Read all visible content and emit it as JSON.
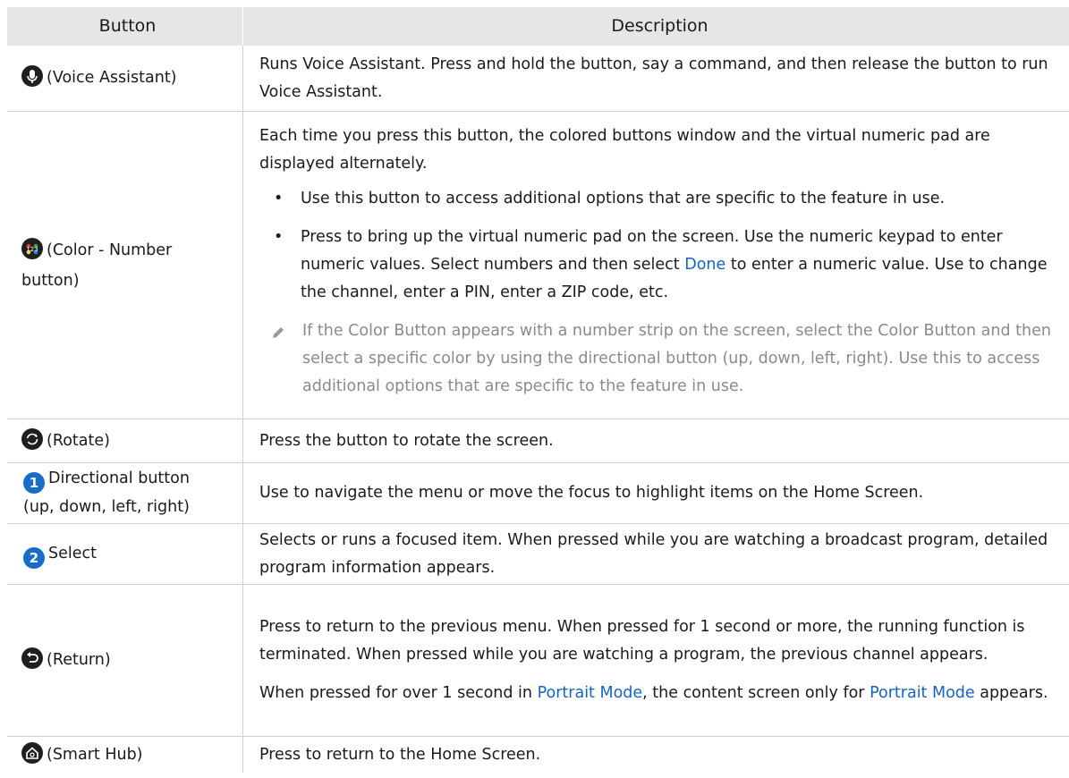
{
  "header": {
    "button": "Button",
    "description": "Description"
  },
  "rows": {
    "voice": {
      "icon": "microphone-icon",
      "label": "(Voice Assistant)",
      "desc": "Runs Voice Assistant. Press and hold the button, say a command, and then release the button to run Voice Assistant."
    },
    "color": {
      "icon": "color-number-icon",
      "label": "(Color - Number button)",
      "desc": "Each time you press this button, the colored buttons window and the virtual numeric pad are displayed alternately.",
      "bullet1": "Use this button to access additional options that are specific to the feature in use.",
      "bullet2_a": "Press to bring up the virtual numeric pad on the screen. Use the numeric keypad to enter numeric values. Select numbers and then select ",
      "bullet2_link": "Done",
      "bullet2_b": " to enter a numeric value. Use to change the channel, enter a PIN, enter a ZIP code, etc.",
      "note": "If the Color Button appears with a number strip on the screen, select the Color Button and then select a specific color by using the directional button (up, down, left, right). Use this to access additional options that are specific to the feature in use."
    },
    "rotate": {
      "icon": "rotate-icon",
      "label": "(Rotate)",
      "desc": "Press the button to rotate the screen."
    },
    "directional": {
      "num": "1",
      "label1": "Directional button",
      "label2": "(up, down, left, right)",
      "desc": "Use to navigate the menu or move the focus to highlight items on the Home Screen."
    },
    "select": {
      "num": "2",
      "label": "Select",
      "desc": "Selects or runs a focused item. When pressed while you are watching a broadcast program, detailed program information appears."
    },
    "return": {
      "icon": "return-icon",
      "label": "(Return)",
      "desc1": "Press to return to the previous menu. When pressed for 1 second or more, the running function is terminated. When pressed while you are watching a program, the previous channel appears.",
      "desc2_a": "When pressed for over 1 second in ",
      "desc2_link1": "Portrait Mode",
      "desc2_b": ", the content screen only for ",
      "desc2_link2": "Portrait Mode",
      "desc2_c": " appears."
    },
    "smarthub": {
      "icon": "home-icon",
      "label": "(Smart Hub)",
      "desc": "Press to return to the Home Screen."
    }
  },
  "colors": {
    "link": "#1565c0",
    "header_bg": "#e6e6e6",
    "number_badge": "#1a6cc9"
  }
}
